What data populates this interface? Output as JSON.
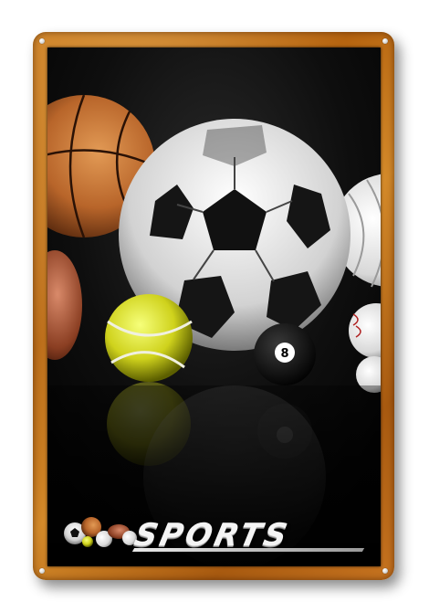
{
  "sign": {
    "logo_text": "SPORTS",
    "frame_color": "#c4711a",
    "background_color": "#080808",
    "billiard_ball_number": "8"
  }
}
